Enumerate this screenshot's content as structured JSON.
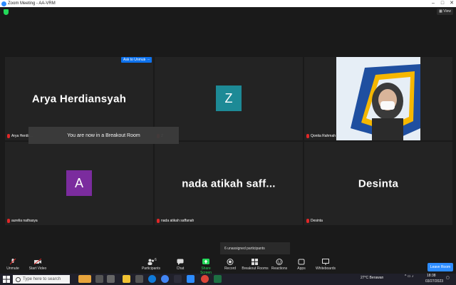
{
  "window": {
    "title": "Zoom Meeting - AA-VRM"
  },
  "topbar": {
    "view_label": "View"
  },
  "participants": [
    {
      "display": "Arya Herdiansyah",
      "nametag": "Arya Herdia..."
    },
    {
      "display": "Z",
      "nametag": "Z",
      "avatar_color": "#1d8a96"
    },
    {
      "display": "",
      "nametag": "Qonita Rahmah"
    },
    {
      "display": "A",
      "nametag": "aurelia nathasya",
      "avatar_color": "#7b2c9e"
    },
    {
      "display": "nada atikah saff...",
      "nametag": "nada atikah saffanah"
    },
    {
      "display": "Desinta",
      "nametag": "Desinta"
    }
  ],
  "overlay": {
    "ask_unmute": "Ask to Unmute",
    "more": "...",
    "breakout_banner": "You are now in a Breakout Room",
    "unassigned": "6 unassigned participants"
  },
  "toolbar": {
    "unmute": "Unmute",
    "start_video": "Start Video",
    "participants": "Participants",
    "participants_count": "6",
    "chat": "Chat",
    "share_screen": "Share Screen",
    "record": "Record",
    "breakout_rooms": "Breakout Rooms",
    "reactions": "Reactions",
    "apps": "Apps",
    "whiteboards": "Whiteboards",
    "leave": "Leave Room"
  },
  "taskbar": {
    "search_placeholder": "Type here to search",
    "weather": "27°C Berawan",
    "time": "18:38",
    "date": "03/27/2023"
  },
  "colors": {
    "accent": "#2d8cff",
    "share_green": "#23d959",
    "mute_red": "#e02828"
  }
}
